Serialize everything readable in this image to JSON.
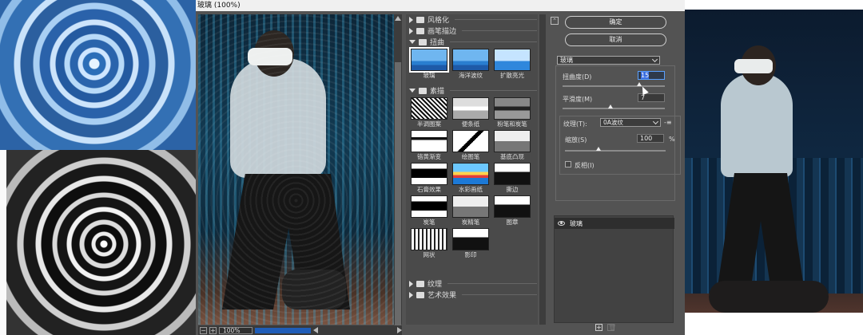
{
  "window": {
    "title": "玻璃 (100%)"
  },
  "preview": {
    "zoom": "100%"
  },
  "gallery": {
    "categories": [
      {
        "label": "风格化",
        "expanded": false
      },
      {
        "label": "画笔描边",
        "expanded": false
      },
      {
        "label": "扭曲",
        "expanded": true
      },
      {
        "label": "素描",
        "expanded": true
      },
      {
        "label": "纹理",
        "expanded": false
      },
      {
        "label": "艺术效果",
        "expanded": false
      }
    ],
    "distort_filters": [
      {
        "label": "玻璃",
        "selected": true
      },
      {
        "label": "海洋波纹",
        "selected": false
      },
      {
        "label": "扩散亮光",
        "selected": false
      }
    ],
    "sketch_filters": [
      {
        "label": "半调图案"
      },
      {
        "label": "便条纸"
      },
      {
        "label": "粉笔和炭笔"
      },
      {
        "label": "铬黄渐变"
      },
      {
        "label": "绘图笔"
      },
      {
        "label": "基底凸现"
      },
      {
        "label": "石膏效果"
      },
      {
        "label": "水彩画纸"
      },
      {
        "label": "撕边"
      },
      {
        "label": "炭笔"
      },
      {
        "label": "炭精笔"
      },
      {
        "label": "图章"
      },
      {
        "label": "网状"
      },
      {
        "label": "影印"
      }
    ]
  },
  "settings": {
    "ok_label": "确定",
    "cancel_label": "取消",
    "filter_select": "玻璃",
    "distortion": {
      "label": "扭曲度(D)",
      "value": "15",
      "level_fraction": 0.75
    },
    "smoothness": {
      "label": "平滑度(M)",
      "value": "7",
      "level_fraction": 0.47
    },
    "texture": {
      "label": "纹理(T):",
      "value": "0A波纹",
      "menu_icon": "-≡"
    },
    "scaling": {
      "label": "缩放(S)",
      "value": "100",
      "unit": "%",
      "level_fraction": 0.33
    },
    "invert": {
      "label": "反相(I)",
      "checked": false
    }
  },
  "layers": {
    "items": [
      {
        "label": "玻璃",
        "visible": true
      }
    ],
    "add_icon": "+",
    "delete_icon": "🗑"
  },
  "colors": {
    "dialog_bg": "#535353",
    "selection_blue": "#3a6ee0"
  }
}
